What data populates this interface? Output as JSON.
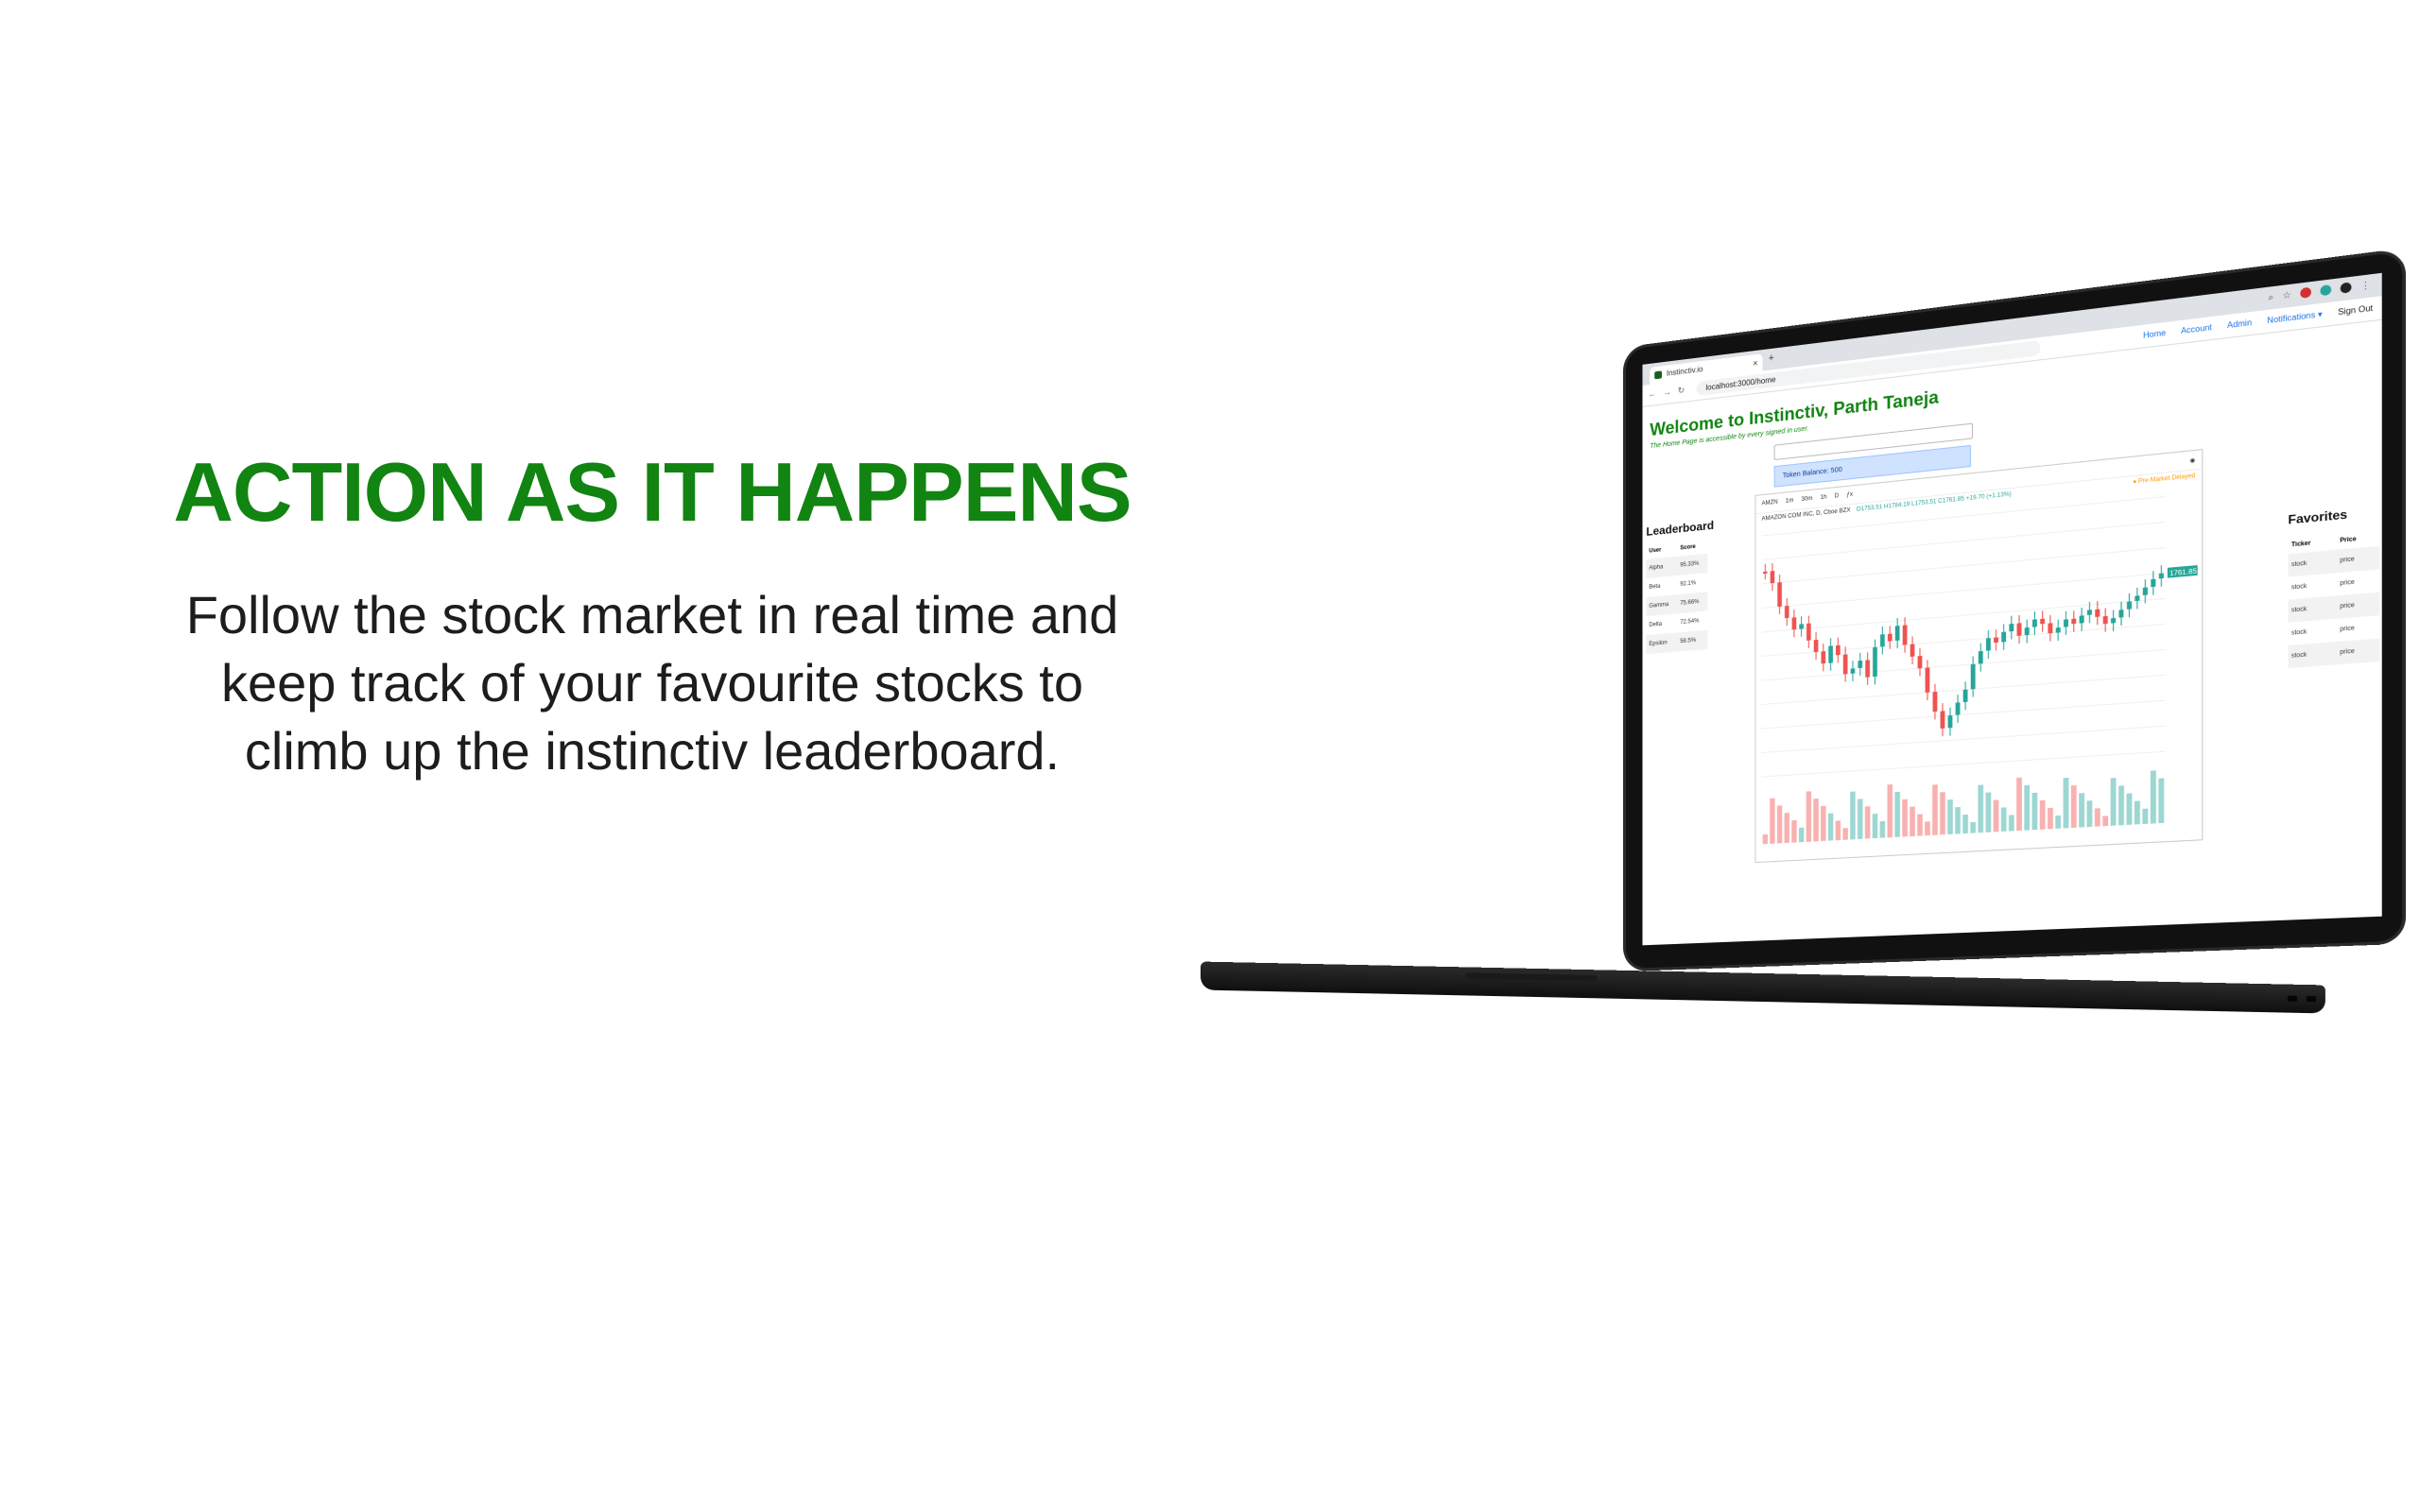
{
  "hero": {
    "title": "ACTION AS IT HAPPENS",
    "body": "Follow the stock market in real time and keep track of your favourite stocks to climb up the instinctiv leaderboard."
  },
  "browser": {
    "tab_title": "Instinctiv.io",
    "url": "localhost:3000/home"
  },
  "app": {
    "nav": [
      {
        "label": "Home"
      },
      {
        "label": "Account"
      },
      {
        "label": "Admin"
      },
      {
        "label": "Notifications ▾"
      },
      {
        "label": "Sign Out"
      }
    ],
    "welcome": "Welcome to Instinctiv, Parth Taneja",
    "subtext": "The Home Page is accessible by every signed in user.",
    "token_balance": "Token Balance: 500",
    "leaderboard": {
      "title": "Leaderboard",
      "headers": [
        "User",
        "Score"
      ],
      "rows": [
        [
          "Alpha",
          "95.33%"
        ],
        [
          "Beta",
          "92.1%"
        ],
        [
          "Gamma",
          "75.66%"
        ],
        [
          "Delta",
          "72.54%"
        ],
        [
          "Epsilon",
          "58.5%"
        ]
      ]
    },
    "chart": {
      "symbol": "AMZN",
      "intervals": [
        "1m",
        "30m",
        "1h",
        "D"
      ],
      "legend": "AMAZON COM INC, D, Cboe BZX",
      "ohlc": "O1753.51 H1784.19 L1753.51 C1761.85 +19.70 (+1.13%)",
      "market_note": "● Pre-Market Delayed",
      "current_price": "1761.85"
    },
    "favorites": {
      "title": "Favorites",
      "headers": [
        "Ticker",
        "Price"
      ],
      "rows": [
        [
          "stock",
          "price"
        ],
        [
          "stock",
          "price"
        ],
        [
          "stock",
          "price"
        ],
        [
          "stock",
          "price"
        ],
        [
          "stock",
          "price"
        ]
      ]
    }
  },
  "colors": {
    "brand_green": "#118411",
    "candle_up": "#26a69a",
    "candle_down": "#ef5350"
  }
}
